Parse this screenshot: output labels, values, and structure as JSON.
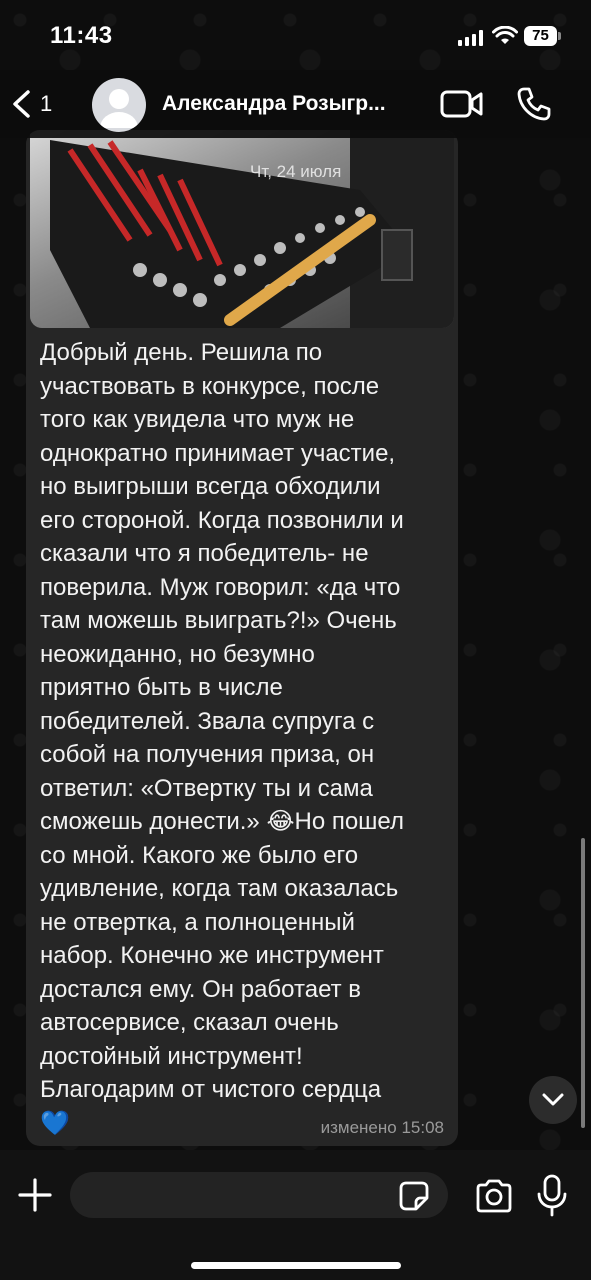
{
  "status_bar": {
    "time": "11:43",
    "battery": "75",
    "icons": [
      "signal-icon",
      "wifi-icon",
      "battery-icon"
    ]
  },
  "header": {
    "back_count": "1",
    "contact_name": "Александра Розыгр...",
    "icons": [
      "back-chevron-icon",
      "avatar-placeholder-icon",
      "video-call-icon",
      "phone-icon"
    ]
  },
  "message": {
    "photo_date": "Чт, 24 июля",
    "text": "Добрый день. Решила по\nучаствовать в конкурсе, после\nтого как увидела что муж не\nоднократно принимает участие,\nно выигрыши всегда обходили\nего стороной. Когда позвонили и\nсказали что я победитель- не\nповерила. Муж говорил: «да что\nтам можешь выиграть?!» Очень\nнеожиданно, но безумно\nприятно быть в числе\nпобедителей. Звала супруга с\nсобой на получения приза, он\nответил: «Отвертку ты и сама\nсможешь донести.» 😂Но пошел\nсо мной. Какого же было его\nудивление, когда там оказалась\nне отвертка, а полноценный\nнабор. Конечно же инструмент\nдостался ему. Он работает в\nавтосервисе, сказал очень\nдостойный инструмент!\nБлагодарим от чистого сердца\n💙",
    "meta": "изменено 15:08"
  },
  "input_bar": {
    "placeholder": "",
    "icons": [
      "plus-icon",
      "sticker-icon",
      "camera-icon",
      "microphone-icon"
    ]
  },
  "colors": {
    "background": "#0b0b0b",
    "bubble": "#262626",
    "meta_text": "#9a9a9a",
    "input_field": "#232323"
  }
}
